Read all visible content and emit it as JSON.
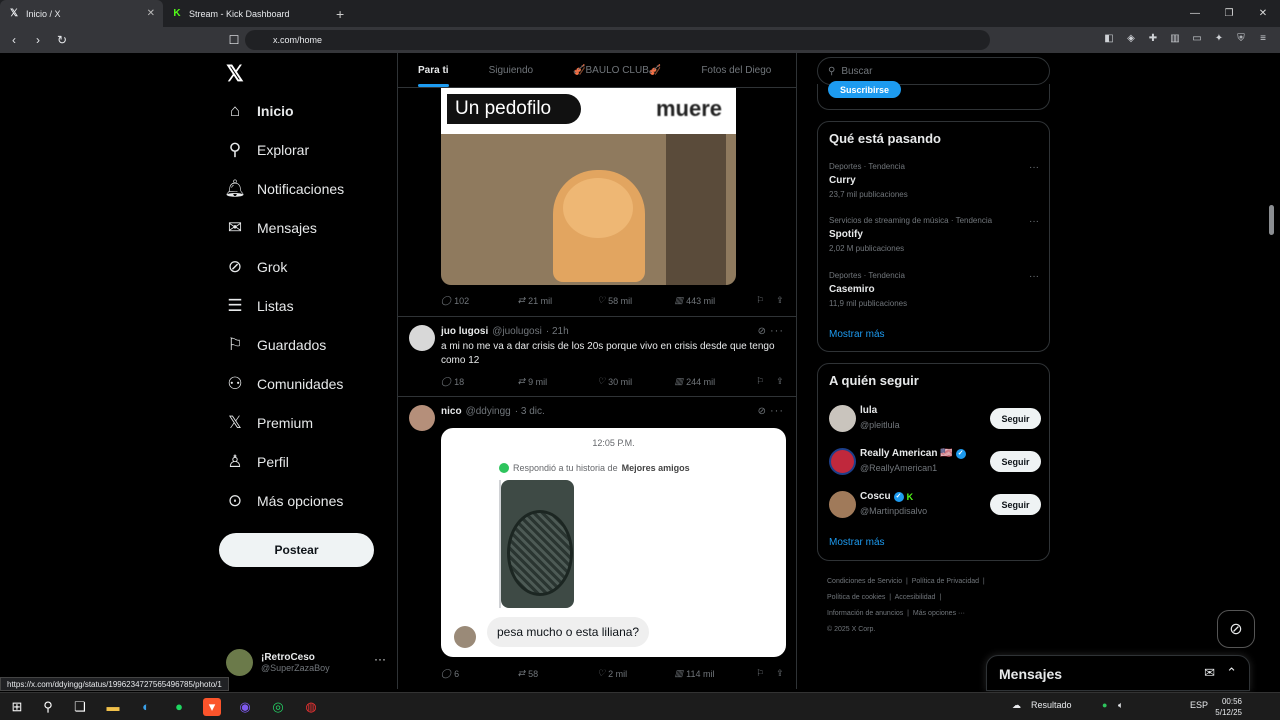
{
  "browser": {
    "tabs": [
      {
        "title": "Inicio / X",
        "favicon": "x-logo-icon"
      },
      {
        "title": "Stream - Kick Dashboard",
        "favicon": "kick-logo-icon"
      }
    ],
    "url": "x.com/home",
    "status_url": "https://x.com/ddyingg/status/1996234727565496785/photo/1"
  },
  "nav": {
    "items": [
      {
        "label": "Inicio",
        "icon": "home-icon"
      },
      {
        "label": "Explorar",
        "icon": "search-icon"
      },
      {
        "label": "Notificaciones",
        "icon": "bell-icon"
      },
      {
        "label": "Mensajes",
        "icon": "mail-icon"
      },
      {
        "label": "Grok",
        "icon": "grok-icon"
      },
      {
        "label": "Listas",
        "icon": "list-icon"
      },
      {
        "label": "Guardados",
        "icon": "bookmark-icon"
      },
      {
        "label": "Comunidades",
        "icon": "communities-icon"
      },
      {
        "label": "Premium",
        "icon": "x-logo-icon"
      },
      {
        "label": "Perfil",
        "icon": "person-icon"
      },
      {
        "label": "Más opciones",
        "icon": "more-circle-icon"
      }
    ],
    "post_label": "Postear",
    "profile": {
      "name": "¡RetroCeso",
      "handle": "@SuperZazaBoy"
    }
  },
  "timeline": {
    "tabs": [
      "Para ti",
      "Siguiendo",
      "🎻BAULO CLUB🎻",
      "Fotos del Diego"
    ],
    "meme": {
      "bubble_text": "Un pedofilo",
      "word_text": "muere"
    },
    "post1_actions": {
      "replies": "102",
      "reposts": "21 mil",
      "likes": "58 mil",
      "views": "443 mil"
    },
    "post2": {
      "name": "juo lugosi",
      "handle": "@juolugosi",
      "time": "· 21h",
      "text": "a mi no me va a dar crisis de los 20s porque vivo en crisis desde que tengo como 12",
      "actions": {
        "replies": "18",
        "reposts": "9 mil",
        "likes": "30 mil",
        "views": "244 mil"
      }
    },
    "post3": {
      "name": "nico",
      "handle": "@ddyingg",
      "time": "· 3 dic.",
      "chat": {
        "time": "12:05 P.M.",
        "replied_prefix": "Respondió a tu historia de",
        "replied_bold": "Mejores amigos",
        "message": "pesa mucho o esta liliana?"
      },
      "actions": {
        "replies": "6",
        "reposts": "58",
        "likes": "2 mil",
        "views": "114 mil"
      }
    }
  },
  "sidebar": {
    "search_placeholder": "Buscar",
    "subscribe_label": "Suscribirse",
    "trends_title": "Qué está pasando",
    "trends": [
      {
        "context": "Deportes · Tendencia",
        "name": "Curry",
        "count": "23,7 mil publicaciones"
      },
      {
        "context": "Servicios de streaming de música · Tendencia",
        "name": "Spotify",
        "count": "2,02 M publicaciones"
      },
      {
        "context": "Deportes · Tendencia",
        "name": "Casemiro",
        "count": "11,9 mil publicaciones"
      }
    ],
    "show_more": "Mostrar más",
    "follow_title": "A quién seguir",
    "follow": [
      {
        "name": "lula",
        "handle": "@pleitlula",
        "badge": ""
      },
      {
        "name": "Really American 🇺🇸",
        "handle": "@ReallyAmerican1",
        "badge": "verified"
      },
      {
        "name": "Coscu",
        "handle": "@Martinpdisalvo",
        "badge": "verified"
      }
    ],
    "follow_button": "Seguir",
    "footer": [
      "Condiciones de Servicio",
      "Política de Privacidad",
      "Política de cookies",
      "Accesibilidad",
      "Información de anuncios",
      "Más opciones ···",
      "© 2025 X Corp."
    ]
  },
  "messages_dock": {
    "title": "Mensajes"
  },
  "taskbar": {
    "weather": "Resultado",
    "lang": "ESP",
    "time": "00:56",
    "date": "5/12/25"
  }
}
